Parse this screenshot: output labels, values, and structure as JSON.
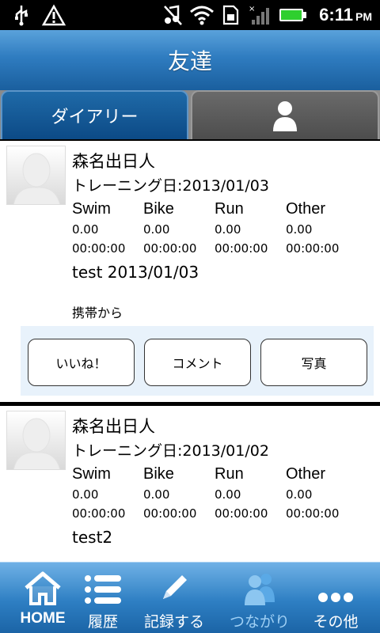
{
  "status_bar": {
    "time": "6:11",
    "ampm": "PM",
    "icons": [
      "usb-icon",
      "warning-icon",
      "music-off-icon",
      "wifi-icon",
      "sim-icon",
      "signal-icon",
      "battery-icon"
    ]
  },
  "header": {
    "title": "友達"
  },
  "tabs": [
    {
      "label": "ダイアリー",
      "selected": true
    },
    {
      "icon": "person-icon",
      "selected": false
    }
  ],
  "posts": [
    {
      "name": "森名出日人",
      "training_date": "トレーニング日:2013/01/03",
      "sports": [
        {
          "label": "Swim",
          "distance": "0.00",
          "time": "00:00:00"
        },
        {
          "label": "Bike",
          "distance": "0.00",
          "time": "00:00:00"
        },
        {
          "label": "Run",
          "distance": "0.00",
          "time": "00:00:00"
        },
        {
          "label": "Other",
          "distance": "0.00",
          "time": "00:00:00"
        }
      ],
      "text": "test 2013/01/03",
      "source": "携帯から",
      "actions": {
        "like": "いいね！",
        "comment": "コメント",
        "photo": "写真"
      }
    },
    {
      "name": "森名出日人",
      "training_date": "トレーニング日:2013/01/02",
      "sports": [
        {
          "label": "Swim",
          "distance": "0.00",
          "time": "00:00:00"
        },
        {
          "label": "Bike",
          "distance": "0.00",
          "time": "00:00:00"
        },
        {
          "label": "Run",
          "distance": "0.00",
          "time": "00:00:00"
        },
        {
          "label": "Other",
          "distance": "0.00",
          "time": "00:00:00"
        }
      ],
      "text": "test2"
    }
  ],
  "bottom_nav": [
    {
      "label": "HOME",
      "icon": "home-icon"
    },
    {
      "label": "履歴",
      "icon": "list-icon"
    },
    {
      "label": "記録する",
      "icon": "pencil-icon"
    },
    {
      "label": "つながり",
      "icon": "people-icon",
      "active": true
    },
    {
      "label": "その他",
      "icon": "more-icon"
    }
  ],
  "colors": {
    "header_blue": "#2f7cc0",
    "tab_selected": "#0c4a86",
    "nav_active_label": "#9fd0f5",
    "action_panel": "#e8f2fb"
  }
}
